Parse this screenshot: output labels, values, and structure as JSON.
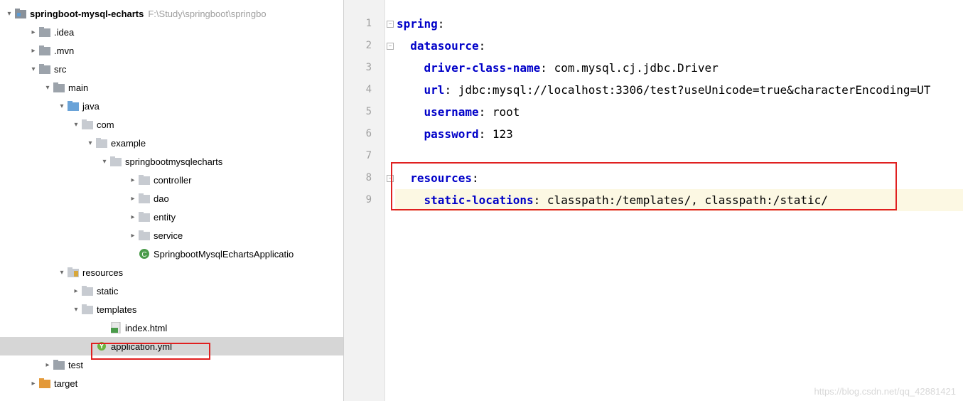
{
  "project": {
    "name": "springboot-mysql-echarts",
    "path": "F:\\Study\\springboot\\springbo"
  },
  "tree": {
    "idea": ".idea",
    "mvn": ".mvn",
    "src": "src",
    "main": "main",
    "java": "java",
    "com": "com",
    "example": "example",
    "pkg": "springbootmysqlecharts",
    "controller": "controller",
    "dao": "dao",
    "entity": "entity",
    "service": "service",
    "appclass": "SpringbootMysqlEchartsApplicatio",
    "resources": "resources",
    "static": "static",
    "templates": "templates",
    "indexhtml": "index.html",
    "appyml": "application.yml",
    "test": "test",
    "target": "target"
  },
  "code": {
    "lines": [
      "1",
      "2",
      "3",
      "4",
      "5",
      "6",
      "7",
      "8",
      "9"
    ],
    "l1_k": "spring",
    "l1_p": ":",
    "l2_k": "datasource",
    "l2_p": ":",
    "l3_k": "driver-class-name",
    "l3_p": ": ",
    "l3_v": "com.mysql.cj.jdbc.Driver",
    "l4_k": "url",
    "l4_p": ": ",
    "l4_v": "jdbc:mysql://localhost:3306/test?useUnicode=true&characterEncoding=UT",
    "l5_k": "username",
    "l5_p": ": ",
    "l5_v": "root",
    "l6_k": "password",
    "l6_p": ": ",
    "l6_v": "123",
    "l8_k": "resources",
    "l8_p": ":",
    "l9_k": "static-locations",
    "l9_p": ": ",
    "l9_v": "classpath:/templates/, classpath:/static/"
  },
  "watermark": "https://blog.csdn.net/qq_42881421"
}
